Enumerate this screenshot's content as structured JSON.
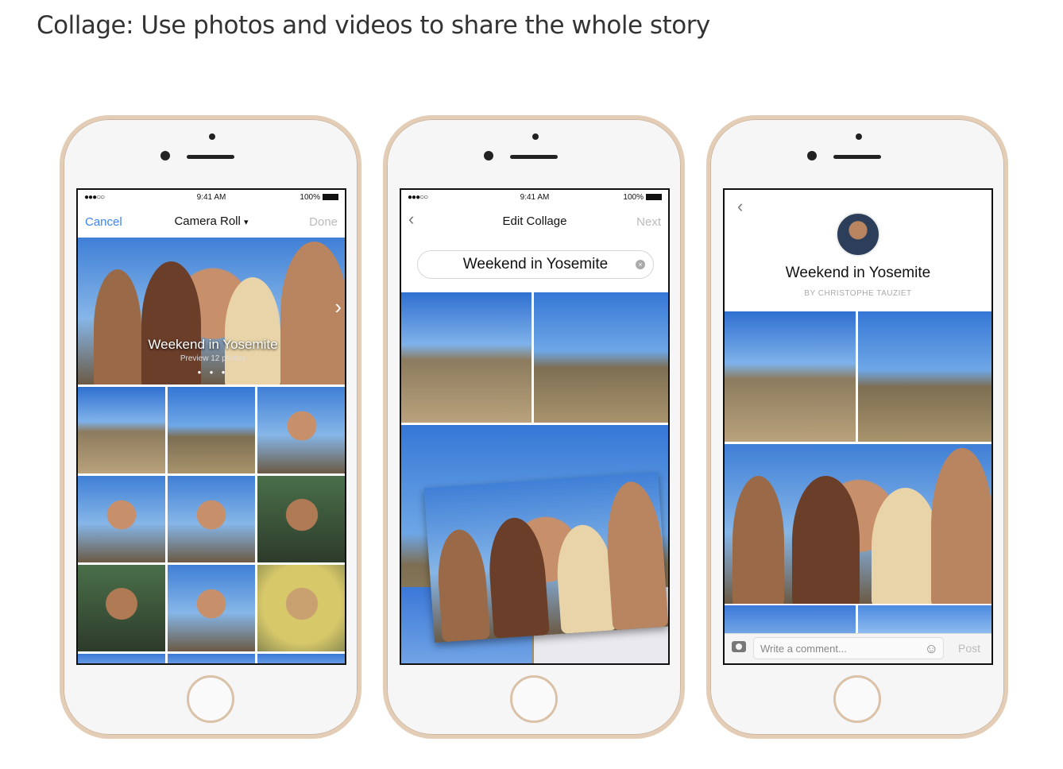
{
  "heading": "Collage: Use photos and videos to share the whole story",
  "status": {
    "signal": "●●●○○",
    "wifi": "wifi-icon",
    "time": "9:41 AM",
    "battery": "100%"
  },
  "phone1": {
    "cancel": "Cancel",
    "title": "Camera Roll",
    "dropdown": "▾",
    "done": "Done",
    "hero_title": "Weekend in Yosemite",
    "hero_subtitle": "Preview 12 photos",
    "page_dots": "● ● ●",
    "next_arrow": "›"
  },
  "phone2": {
    "back": "‹",
    "title": "Edit Collage",
    "next": "Next",
    "collage_title": "Weekend in Yosemite",
    "clear": "×"
  },
  "phone3": {
    "back": "‹",
    "title": "Weekend in Yosemite",
    "byline": "BY CHRISTOPHE TAUZIET",
    "comment_placeholder": "Write a comment...",
    "post": "Post",
    "camera_icon": "camera-icon",
    "emoji_icon": "smiley-icon"
  }
}
